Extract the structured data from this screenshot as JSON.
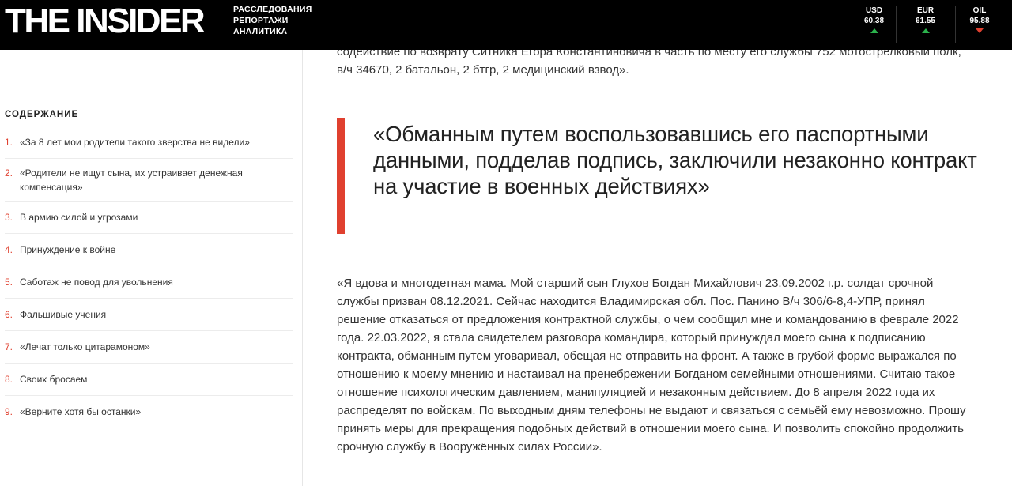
{
  "header": {
    "logo": "THE INSIDER",
    "tagline": [
      "РАССЛЕДОВАНИЯ",
      "РЕПОРТАЖИ",
      "АНАЛИТИКА"
    ],
    "rates": [
      {
        "name": "USD",
        "value": "60.38",
        "trend": "up"
      },
      {
        "name": "EUR",
        "value": "61.55",
        "trend": "up"
      },
      {
        "name": "OIL",
        "value": "95.88",
        "trend": "down"
      }
    ]
  },
  "toc": {
    "title": "СОДЕРЖАНИЕ",
    "items": [
      {
        "num": "1.",
        "label": "«За 8 лет мои родители такого зверства не видели»"
      },
      {
        "num": "2.",
        "label": "«Родители не ищут сына, их устраивает денежная компенсация»"
      },
      {
        "num": "3.",
        "label": "В армию силой и угрозами"
      },
      {
        "num": "4.",
        "label": "Принуждение к войне"
      },
      {
        "num": "5.",
        "label": "Саботаж не повод для увольнения"
      },
      {
        "num": "6.",
        "label": "Фальшивые учения"
      },
      {
        "num": "7.",
        "label": "«Лечат только цитарамоном»"
      },
      {
        "num": "8.",
        "label": "Своих бросаем"
      },
      {
        "num": "9.",
        "label": "«Верните хотя бы останки»"
      }
    ]
  },
  "article": {
    "para_top": "содействие по возврату Ситника Егора Константиновича в часть по месту его службы 752 мотострелковый полк, в/ч 34670, 2 батальон, 2 бтгр, 2 медицинский взвод».",
    "quote": "«Обманным путем воспользовавшись его паспортными данными, подделав подпись, заключили незаконно контракт на участие в военных действиях»",
    "para": "«Я вдова и многодетная мама. Мой старший сын Глухов Богдан Михайлович 23.09.2002 г.р. солдат срочной службы призван 08.12.2021. Сейчас находится Владимирская обл. Пос. Панино В/ч 306/6-8,4-УПР, принял решение отказаться от предложения контрактной службы, о чем сообщил мне и командованию в феврале 2022 года. 22.03.2022, я стала свидетелем разговора командира, который принуждал моего сына к подписанию контракта, обманным путем уговаривал, обещая не отправить на фронт. А также в грубой форме выражался по отношению к моему мнению и настаивал на пренебрежении Богданом семейными отношениями. Считаю такое отношение психологическим давлением, манипуляцией и незаконным действием. До 8 апреля 2022 года их распределят по войскам. По выходным дням телефоны не выдают и связаться с семьёй ему невозможно. Прошу принять меры для прекращения подобных действий в отношении моего сына. И позволить спокойно продолжить срочную службу в Вооружённых силах России»."
  },
  "colors": {
    "accent": "#e0402f",
    "up": "#2bb24c",
    "down": "#e0402f"
  }
}
